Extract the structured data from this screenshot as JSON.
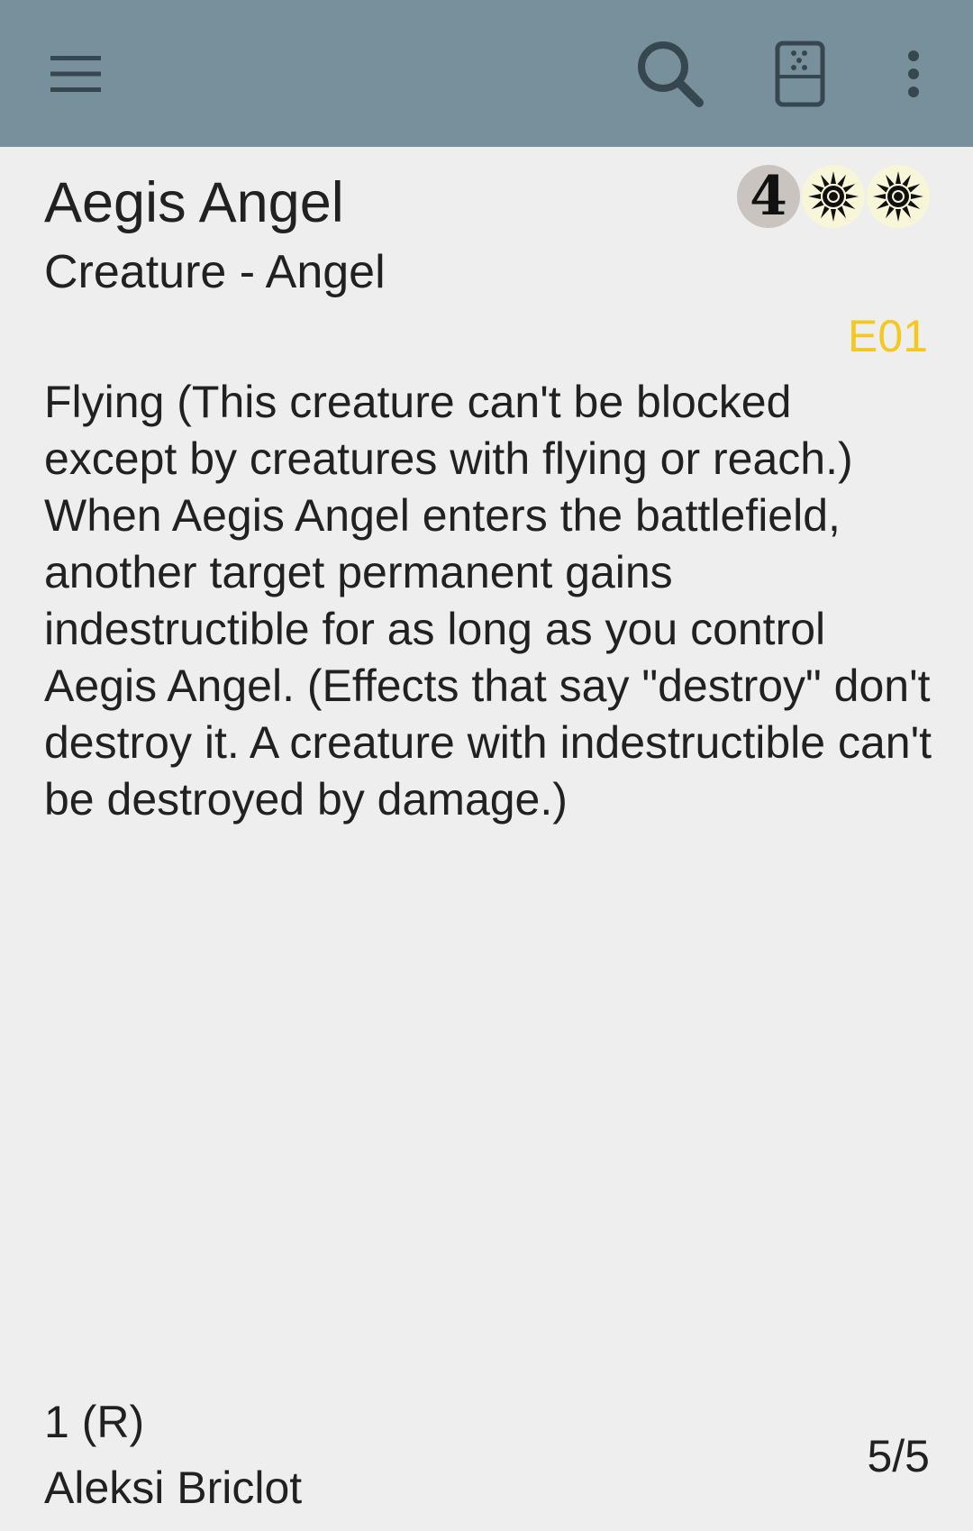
{
  "toolbar": {
    "menu_icon": "hamburger-menu-icon",
    "search_icon": "search-icon",
    "random_icon": "random-card-icon",
    "overflow_icon": "more-vert-icon",
    "background_color": "#78909c"
  },
  "card": {
    "name": "Aegis Angel",
    "mana_cost": {
      "generic": "4",
      "colored": [
        "W",
        "W"
      ]
    },
    "type_line": "Creature - Angel",
    "set_code": "E01",
    "set_code_color": "#f4c81f",
    "rules_text": [
      "Flying (This creature can't be blocked except by creatures with flying or reach.)",
      "When Aegis Angel enters the battlefield, another target permanent gains indestructible for as long as you control Aegis Angel. (Effects that say \"destroy\" don't destroy it. A creature with indestructible can't be destroyed by damage.)"
    ],
    "collector_info": "1 (R)",
    "artist": "Aleksi Briclot",
    "power_toughness": "5/5"
  }
}
